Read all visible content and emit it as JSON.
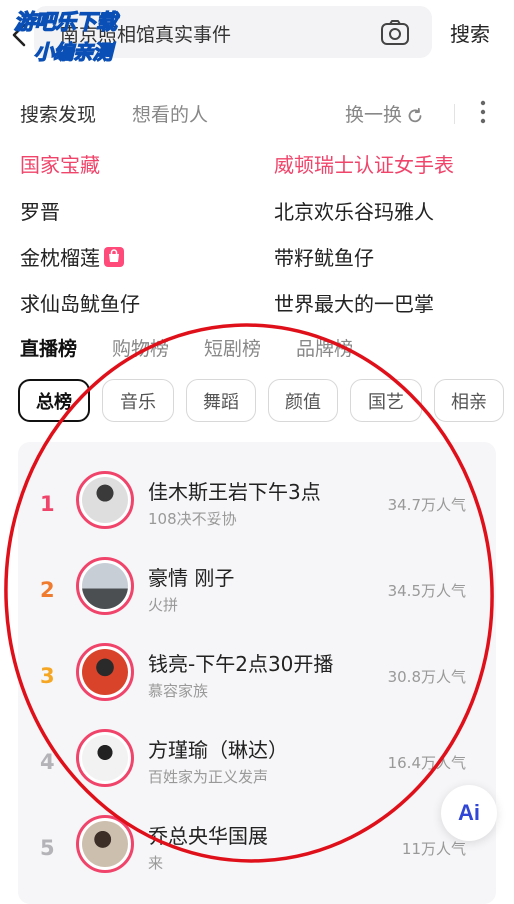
{
  "watermark": {
    "line1": "游吧乐下载",
    "line2": "小编亲测"
  },
  "search": {
    "query": "南京照相馆真实事件",
    "button_label": "搜索"
  },
  "discovery": {
    "title": "搜索发现",
    "tab2": "想看的人",
    "refresh_label": "换一换",
    "items": [
      {
        "label": "国家宝藏",
        "hot": true
      },
      {
        "label": "威顿瑞士认证女手表",
        "hot": true
      },
      {
        "label": "罗晋",
        "hot": false
      },
      {
        "label": "北京欢乐谷玛雅人",
        "hot": false
      },
      {
        "label": "金枕榴莲",
        "hot": false,
        "badge": "shop"
      },
      {
        "label": "带籽鱿鱼仔",
        "hot": false
      },
      {
        "label": "求仙岛鱿鱼仔",
        "hot": false
      },
      {
        "label": "世界最大的一巴掌",
        "hot": false
      }
    ]
  },
  "ranking": {
    "tabs": [
      "直播榜",
      "购物榜",
      "短剧榜",
      "品牌榜"
    ],
    "active_tab": "直播榜",
    "chips": [
      "总榜",
      "音乐",
      "舞蹈",
      "颜值",
      "国艺",
      "相亲"
    ],
    "active_chip": "总榜",
    "rows": [
      {
        "rank": "1",
        "name": "佳木斯王岩下午3点",
        "sub": "108决不妥协",
        "popularity": "34.7万人气",
        "rank_color": "#f0446b"
      },
      {
        "rank": "2",
        "name": "豪情 刚子",
        "sub": "火拼",
        "popularity": "34.5万人气",
        "rank_color": "#f07a2e"
      },
      {
        "rank": "3",
        "name": "钱亮-下午2点30开播",
        "sub": "慕容家族",
        "popularity": "30.8万人气",
        "rank_color": "#f5a623"
      },
      {
        "rank": "4",
        "name": "方瑾瑜（琳达）",
        "sub": "百姓家为正义发声",
        "popularity": "16.4万人气",
        "rank_color": "#b4b4b8"
      },
      {
        "rank": "5",
        "name": "乔总央华国展",
        "sub": "来",
        "popularity": "11万人气",
        "rank_color": "#b4b4b8"
      }
    ]
  },
  "ai_button": {
    "label": "Ai"
  },
  "colors": {
    "accent": "#f0446b",
    "annotation": "#e0101a"
  }
}
